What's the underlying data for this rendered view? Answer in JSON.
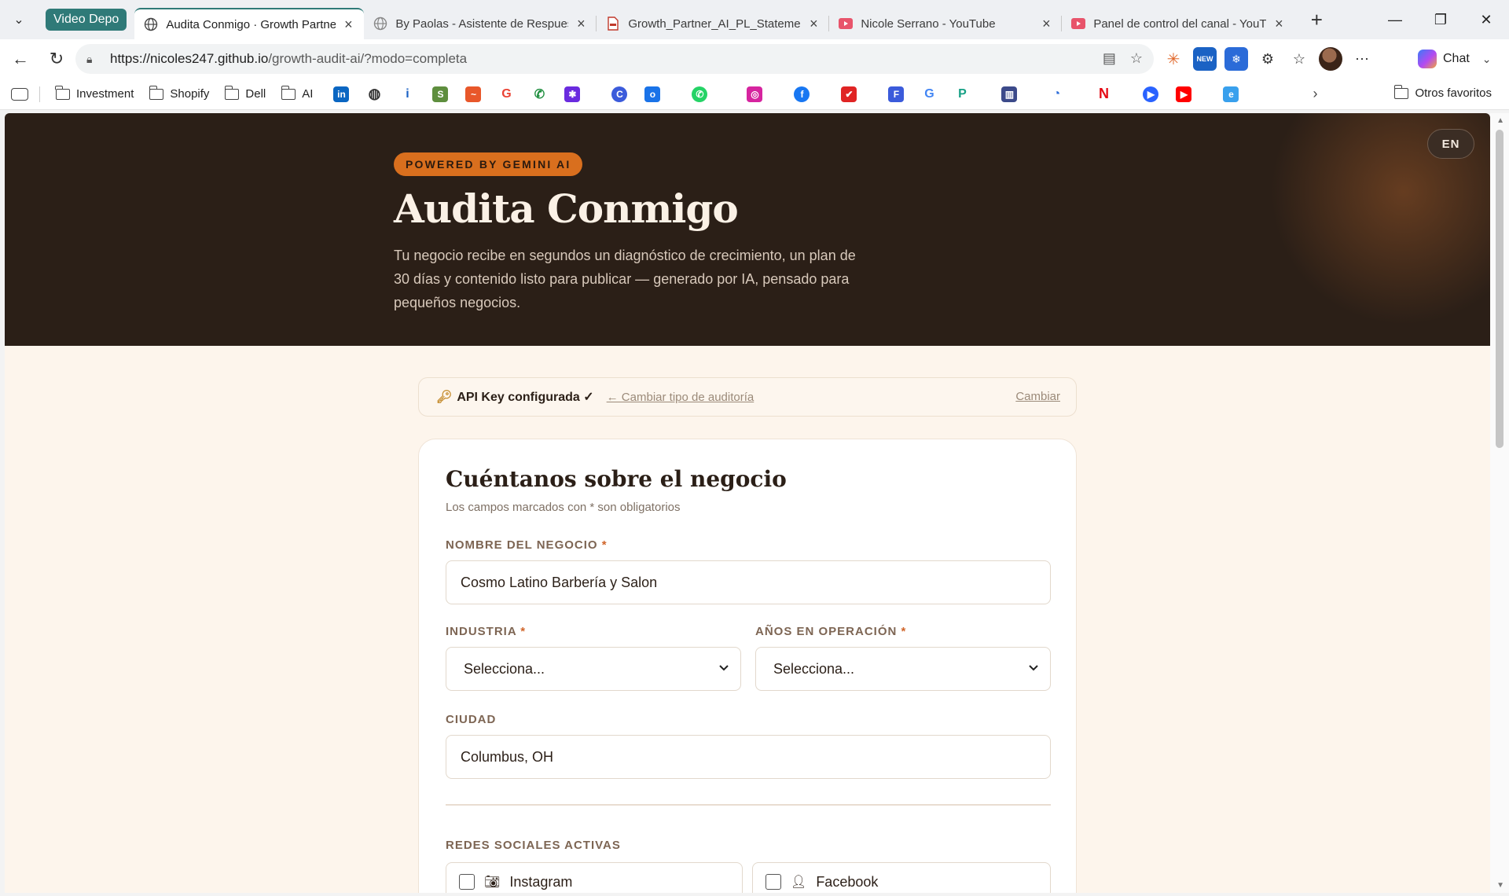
{
  "browser": {
    "tab_group": "Video Depo",
    "tabs": [
      {
        "title": "Audita Conmigo · Growth Partner AI",
        "active": true,
        "icon": "globe-icon"
      },
      {
        "title": "By Paolas - Asistente de Respuestas",
        "active": false,
        "icon": "globe-icon"
      },
      {
        "title": "Growth_Partner_AI_PL_Statement.pdf",
        "active": false,
        "icon": "pdf-icon"
      },
      {
        "title": "Nicole Serrano - YouTube",
        "active": false,
        "icon": "youtube-icon"
      },
      {
        "title": "Panel de control del canal - YouTube Studio",
        "active": false,
        "icon": "youtube-icon"
      }
    ],
    "url_host": "https://nicoles247.github.io",
    "url_path": "/growth-audit-ai/?modo=completa",
    "chat_label": "Chat",
    "bookmark_folders": [
      "Investment",
      "Shopify",
      "Dell",
      "AI"
    ],
    "other_favorites": "Otros favoritos"
  },
  "hero": {
    "badge": "POWERED BY GEMINI AI",
    "title": "Audita Conmigo",
    "subtitle": "Tu negocio recibe en segundos un diagnóstico de crecimiento, un plan de 30 días y contenido listo para publicar — generado por IA, pensado para pequeños negocios.",
    "lang_button": "EN"
  },
  "api_bar": {
    "status": "API Key configurada ✓",
    "switch_link": "← Cambiar tipo de auditoría",
    "change_link": "Cambiar"
  },
  "form": {
    "title": "Cuéntanos sobre el negocio",
    "note": "Los campos marcados con * son obligatorios",
    "business_name_label": "NOMBRE DEL NEGOCIO",
    "business_name_value": "Cosmo Latino Barbería y Salon",
    "industry_label": "INDUSTRIA",
    "industry_value": "Selecciona...",
    "years_label": "AÑOS EN OPERACIÓN",
    "years_value": "Selecciona...",
    "city_label": "CIUDAD",
    "city_value": "Columbus, OH",
    "social_label": "REDES SOCIALES ACTIVAS",
    "social_options": [
      "Instagram",
      "Facebook"
    ],
    "required_mark": "*"
  },
  "colors": {
    "hero_bg": "#2b1f17",
    "accent": "#d96f1e",
    "page_bg": "#fdf5ec",
    "tab_group": "#2f7a78"
  }
}
